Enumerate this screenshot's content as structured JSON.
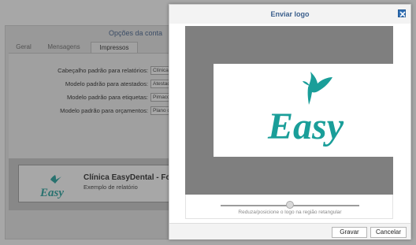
{
  "account_dialog": {
    "title": "Opções da conta",
    "tabs": [
      "Geral",
      "Mensagens",
      "Impressos"
    ],
    "active_tab": "Impressos",
    "fields": [
      {
        "label": "Cabeçalho padrão para relatórios:",
        "value": "Clínica"
      },
      {
        "label": "Modelo padrão para atestados:",
        "value": "Atestad"
      },
      {
        "label": "Modelo padrão para etiquetas:",
        "value": "Pimaco"
      },
      {
        "label": "Modelo padrão para orçamentos:",
        "value": "Plano d"
      }
    ],
    "preview": {
      "clinic_name": "Clínica EasyDental - For",
      "report_label": "Exemplo de relatório",
      "logo_text": "Easy"
    }
  },
  "upload_dialog": {
    "title": "Enviar logo",
    "close_icon": "close-icon",
    "logo_text": "Easy",
    "brand_color": "#1a9e99",
    "zoom_level": 0.5,
    "slider_hint": "Reduza/posicione o logo na região retangular",
    "buttons": {
      "save": "Gravar",
      "cancel": "Cancelar"
    }
  }
}
